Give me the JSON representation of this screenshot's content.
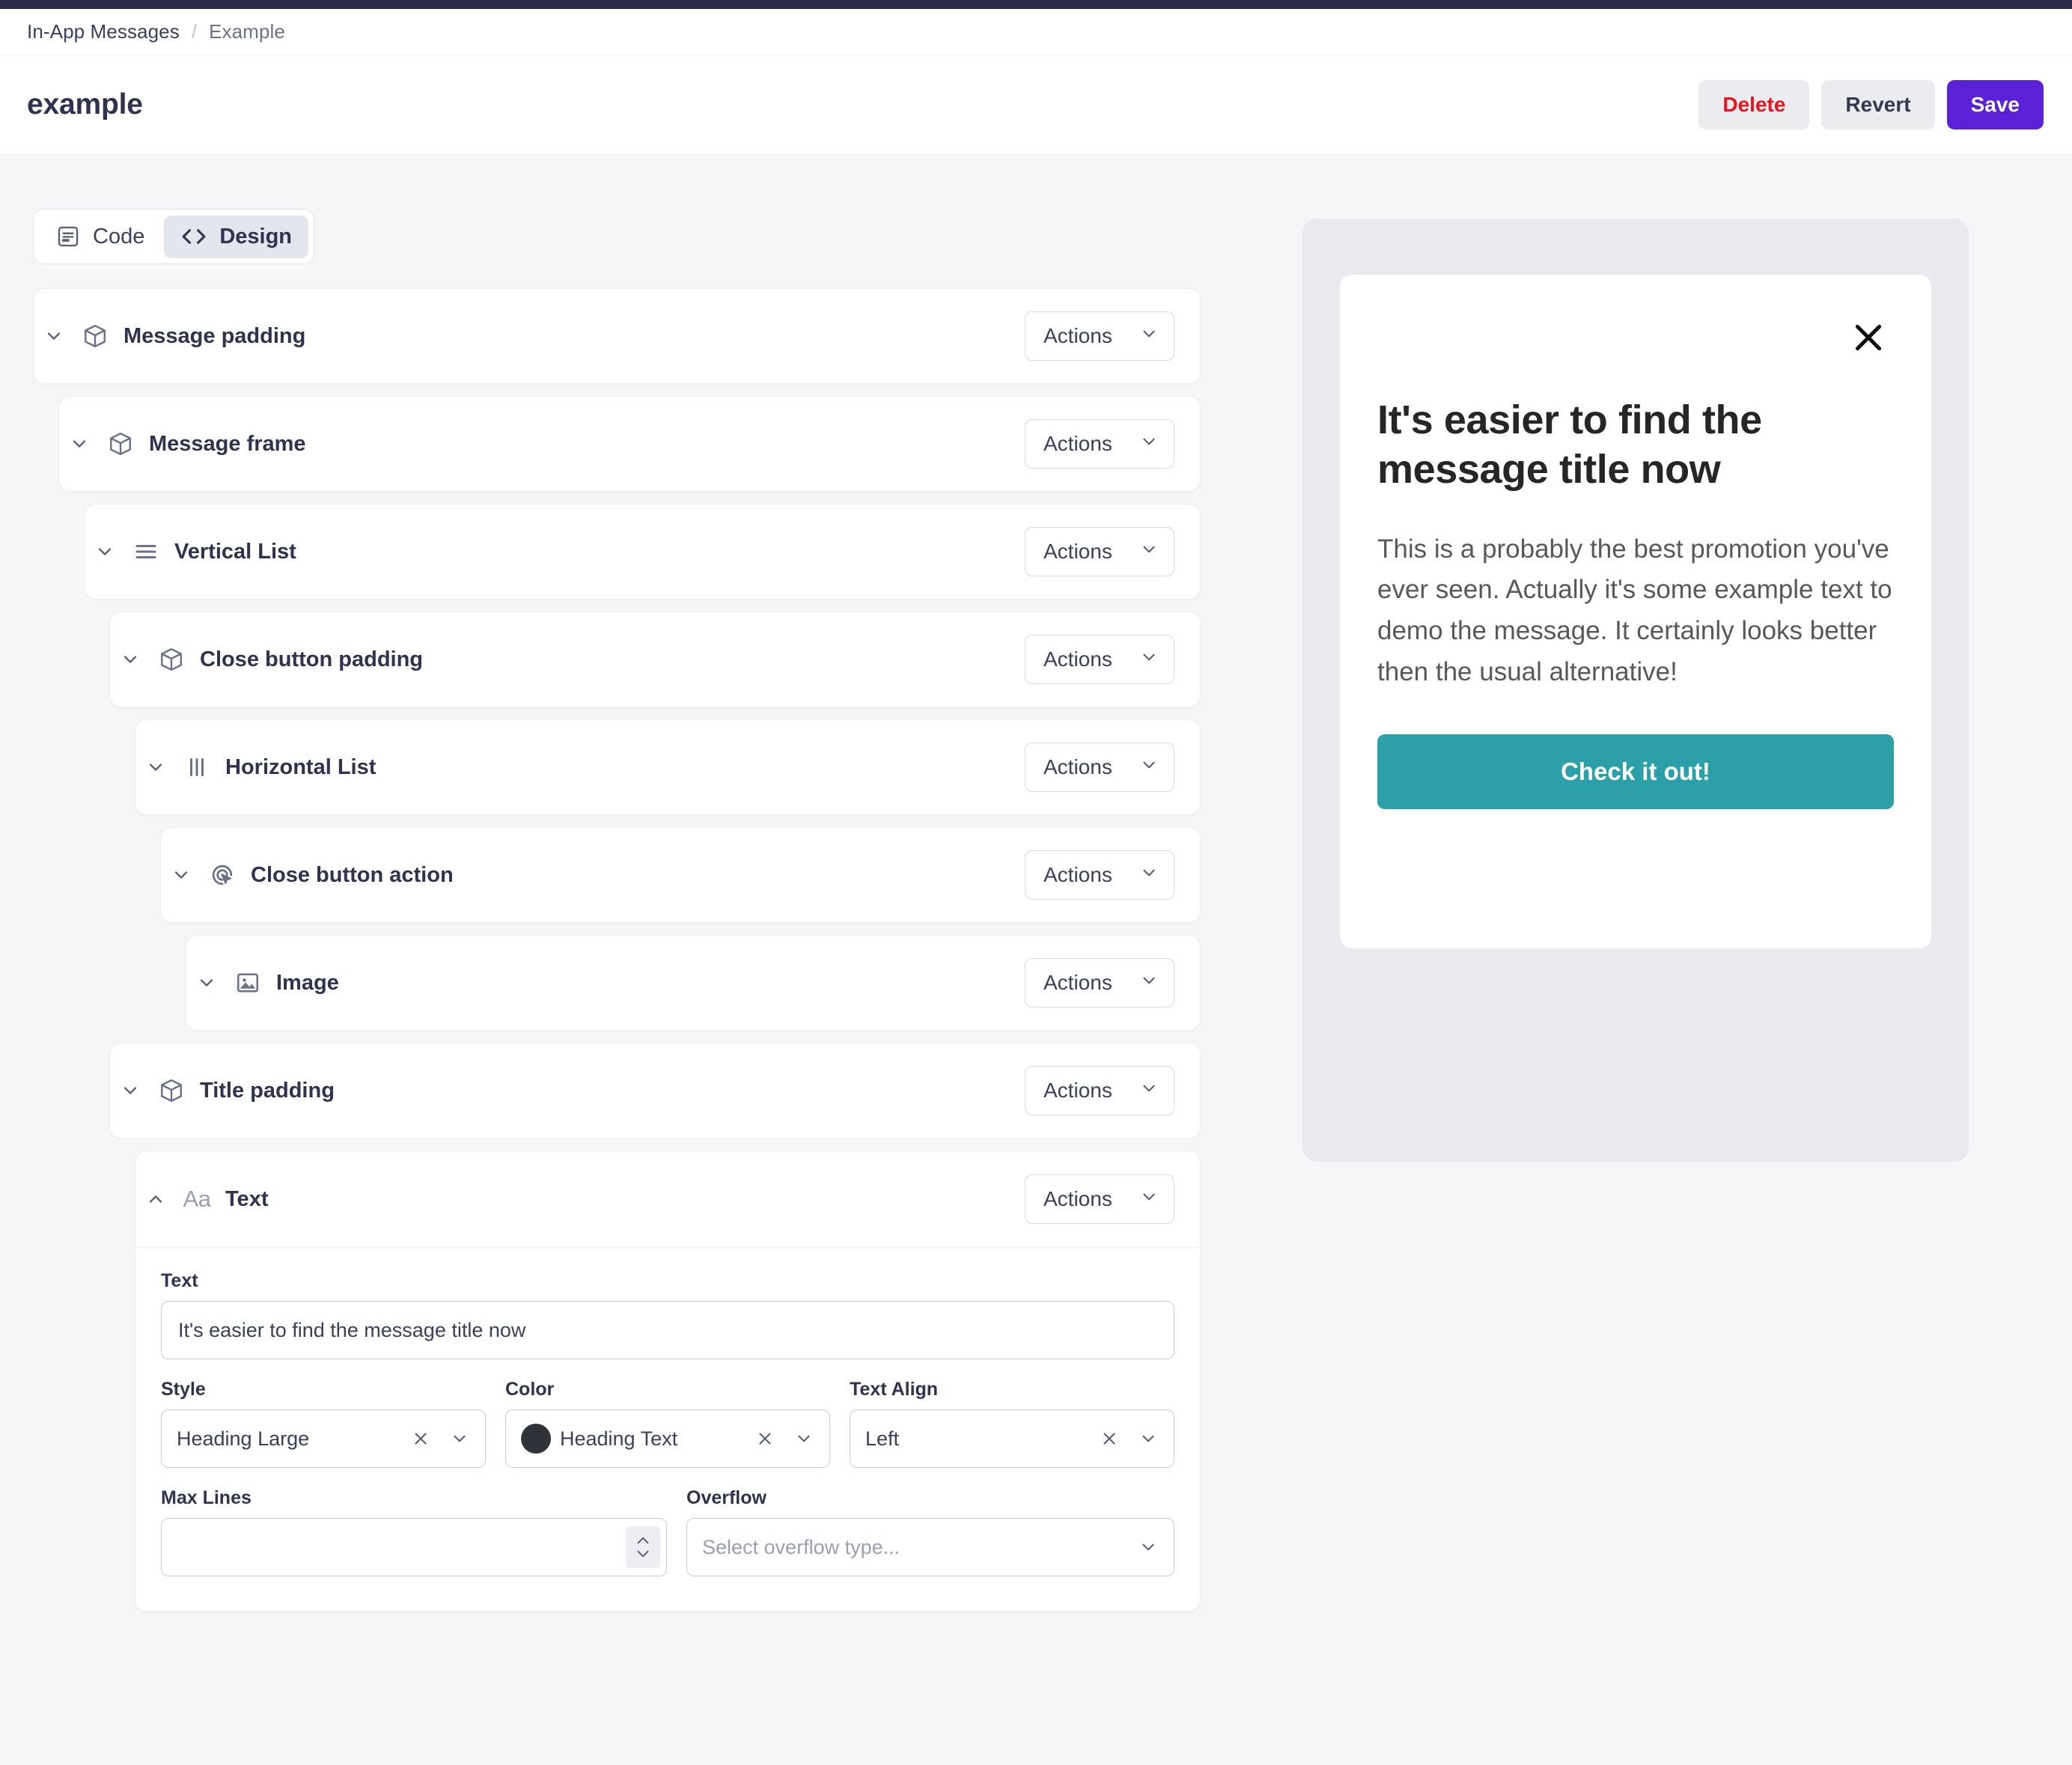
{
  "topbar": {
    "accent_color": "#2b2d4a"
  },
  "breadcrumb": {
    "parent": "In-App Messages",
    "separator": "/",
    "current": "Example"
  },
  "header": {
    "title": "example",
    "buttons": {
      "delete": "Delete",
      "revert": "Revert",
      "save": "Save"
    },
    "colors": {
      "delete_text": "#e8141e",
      "save_bg": "#5b21d6"
    }
  },
  "mode_toggle": {
    "code": {
      "label": "Code",
      "icon": "document-icon",
      "active": false
    },
    "design": {
      "label": "Design",
      "icon": "code-brackets-icon",
      "active": true
    }
  },
  "tree": {
    "actions_label": "Actions",
    "nodes": [
      {
        "label": "Message padding",
        "icon": "cube-icon",
        "indent": 0,
        "expanded": true
      },
      {
        "label": "Message frame",
        "icon": "cube-icon",
        "indent": 1,
        "expanded": true
      },
      {
        "label": "Vertical List",
        "icon": "vertical-list-icon",
        "indent": 2,
        "expanded": true
      },
      {
        "label": "Close button padding",
        "icon": "cube-icon",
        "indent": 3,
        "expanded": true
      },
      {
        "label": "Horizontal List",
        "icon": "horizontal-list-icon",
        "indent": 4,
        "expanded": true
      },
      {
        "label": "Close button action",
        "icon": "click-action-icon",
        "indent": 5,
        "expanded": true
      },
      {
        "label": "Image",
        "icon": "image-icon",
        "indent": 6,
        "expanded": true
      },
      {
        "label": "Title padding",
        "icon": "cube-icon",
        "indent": 3,
        "expanded": true
      }
    ],
    "text_node": {
      "label": "Text",
      "icon": "aa-text-icon",
      "icon_glyph": "Aa",
      "indent": 4,
      "expanded": true
    }
  },
  "text_panel": {
    "text_field": {
      "label": "Text",
      "value": "It's easier to find the message title now"
    },
    "style_field": {
      "label": "Style",
      "value": "Heading Large"
    },
    "color_field": {
      "label": "Color",
      "value": "Heading Text",
      "swatch_color": "#2f3238"
    },
    "text_align_field": {
      "label": "Text Align",
      "value": "Left"
    },
    "max_lines_field": {
      "label": "Max Lines",
      "value": "",
      "placeholder": ""
    },
    "overflow_field": {
      "label": "Overflow",
      "value": "",
      "placeholder": "Select overflow type..."
    }
  },
  "preview": {
    "close_icon": "close-icon",
    "title": "It's easier to find the message title now",
    "body": "This is a probably the best promotion you've ever seen. Actually it's some example text to demo the message. It certainly looks better then the usual alternative!",
    "cta_label": "Check it out!",
    "cta_color": "#2ba0a8",
    "panel_bg": "#e9eaef"
  }
}
